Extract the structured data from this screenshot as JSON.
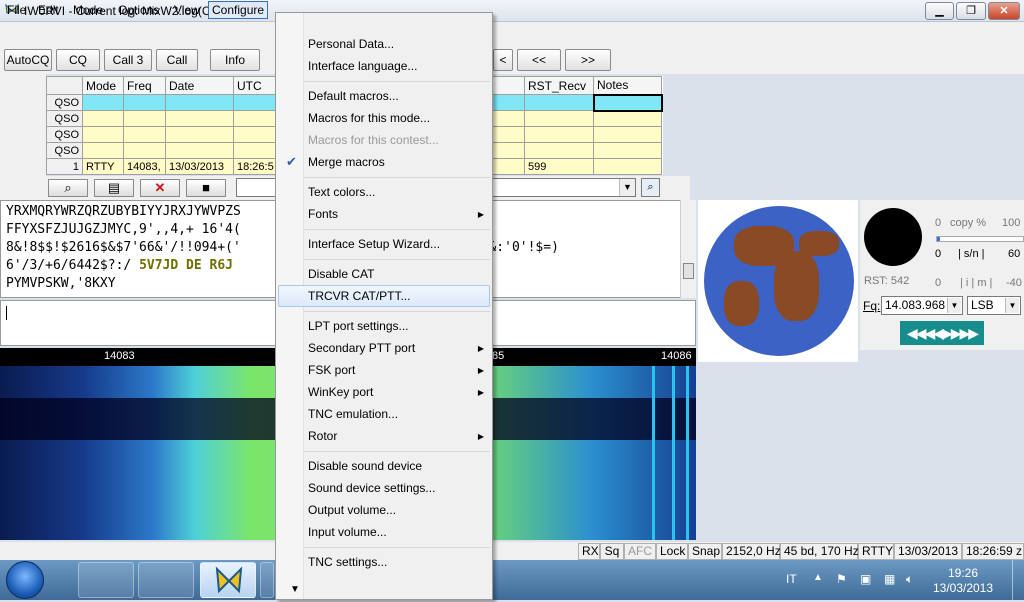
{
  "window": {
    "title": "IW0RVI - Current log: MixW2.log(CSV)",
    "min": "▁",
    "max": "❐",
    "close": "✕"
  },
  "menubar": [
    "File",
    "Edit",
    "Mode",
    "Options",
    "View",
    "Configure"
  ],
  "toolbar": {
    "autocq": "AutoCQ",
    "cq": "CQ",
    "call3": "Call 3",
    "call": "Call",
    "info": "Info",
    "prev": "<",
    "rew": "<<",
    "fwd": ">>"
  },
  "log": {
    "columns": [
      "Mode",
      "Freq",
      "Date",
      "UTC",
      "ent",
      "RST_Recv",
      "Notes"
    ],
    "rows": [
      {
        "head": "QSO",
        "mode": "",
        "freq": "",
        "date": "",
        "utc": "",
        "ent": "",
        "rst": "",
        "notes": ""
      },
      {
        "head": "QSO",
        "mode": "",
        "freq": "",
        "date": "",
        "utc": "",
        "ent": "",
        "rst": "",
        "notes": ""
      },
      {
        "head": "QSO",
        "mode": "",
        "freq": "",
        "date": "",
        "utc": "",
        "ent": "",
        "rst": "",
        "notes": ""
      },
      {
        "head": "QSO",
        "mode": "",
        "freq": "",
        "date": "",
        "utc": "",
        "ent": "",
        "rst": "",
        "notes": ""
      },
      {
        "head": "1",
        "mode": "RTTY",
        "freq": "14083,",
        "date": "13/03/2013",
        "utc": "18:26:5",
        "ent": "",
        "rst": "599",
        "notes": ""
      }
    ]
  },
  "rx": {
    "line1": "YRXMQRYWRZQRZUBYBIYYJRXJYWVPZS",
    "line2": "FFYXSFZJUJGZJMYC,9',,4,+ 16'4(",
    "line3a": "8&!8$$!$2616$&$7'66&'/!!094+('",
    "line3b": "66&:'0'!$=)",
    "line4a": "6'/3/+6/6442$?:/ ",
    "line4call": "5V7JD DE R6J",
    "line5": "PYMVPSKW,'8KXY"
  },
  "waterfall": {
    "f1": "14083",
    "f2": "85",
    "f3": "14086"
  },
  "meters": {
    "copy_min": "0",
    "copy_lbl": "copy %",
    "copy_max": "100",
    "sn_min": "0",
    "sn_lbl": "| s/n |",
    "sn_max": "60",
    "rst": "RST: 542",
    "il_min": "0",
    "il_lbl": "| i | m |",
    "il_max": "-40",
    "eq_label": "Fq:",
    "frequency": "14.083.968",
    "sideband": "LSB",
    "nav": "◀◀◀◀▶▶▶▶"
  },
  "status": {
    "rx": "RX",
    "sq": "Sq",
    "afc": "AFC",
    "lock": "Lock",
    "snap": "Snap",
    "offset": "2152,0 Hz",
    "baud": "45 bd, 170 Hz",
    "mode": "RTTY",
    "date": "13/03/2013",
    "time": "18:26:59 z"
  },
  "taskbar": {
    "lang": "IT",
    "up": "▲",
    "time": "19:26",
    "date": "13/03/2013"
  },
  "menu": {
    "personal": "Personal Data...",
    "language": "Interface language...",
    "default_macros": "Default macros...",
    "macros_mode": "Macros for this mode...",
    "macros_contest": "Macros for this contest...",
    "merge": "Merge macros",
    "check": "✔",
    "text_colors": "Text colors...",
    "fonts": "Fonts",
    "wizard": "Interface Setup Wizard...",
    "disable_cat": "Disable CAT",
    "trcvr": "TRCVR CAT/PTT...",
    "lpt": "LPT port settings...",
    "secondary_ptt": "Secondary PTT port",
    "fsk": "FSK port",
    "winkey": "WinKey port",
    "tnc_emu": "TNC emulation...",
    "rotor": "Rotor",
    "disable_sound": "Disable sound device",
    "sound_settings": "Sound device settings...",
    "output_vol": "Output volume...",
    "input_vol": "Input volume...",
    "tnc_settings": "TNC settings...",
    "more": "▼",
    "arrow": "▶"
  },
  "colors": {
    "accent": "#3b6fb6",
    "hover": "#dbe9fa",
    "waterfall_line": "#29c3ee",
    "nav": "#188d8d"
  }
}
